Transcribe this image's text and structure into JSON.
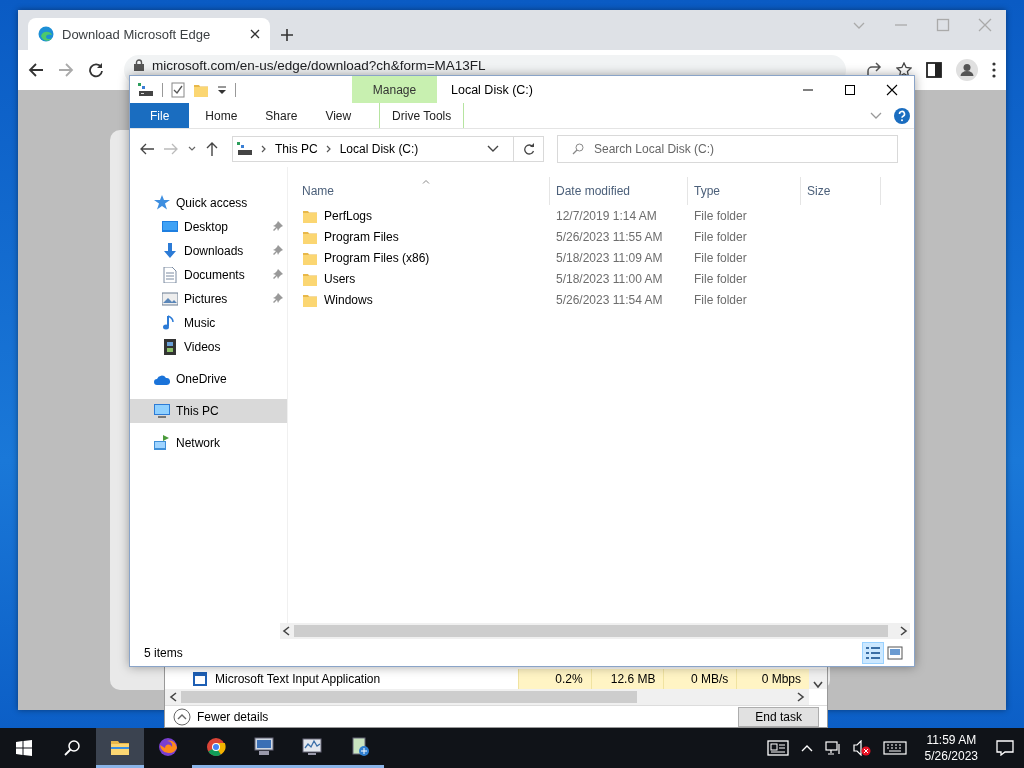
{
  "browser": {
    "tab_title": "Download Microsoft Edge",
    "address": "microsoft.com/en-us/edge/download?ch&form=MA13FL"
  },
  "explorer": {
    "title": "Local Disk (C:)",
    "context_group": "Manage",
    "ribbon_tabs": [
      {
        "label": "File",
        "kind": "file"
      },
      {
        "label": "Home",
        "kind": "plain"
      },
      {
        "label": "Share",
        "kind": "plain"
      },
      {
        "label": "View",
        "kind": "plain"
      },
      {
        "label": "Drive Tools",
        "kind": "context"
      }
    ],
    "breadcrumb": [
      "This PC",
      "Local Disk (C:)"
    ],
    "search": {
      "placeholder": "Search Local Disk (C:)"
    },
    "nav": [
      {
        "label": "Quick access",
        "selected": false,
        "children": [
          {
            "label": "Desktop",
            "pinned": true,
            "selected": false
          },
          {
            "label": "Downloads",
            "pinned": true,
            "selected": false
          },
          {
            "label": "Documents",
            "pinned": true,
            "selected": false
          },
          {
            "label": "Pictures",
            "pinned": true,
            "selected": false
          },
          {
            "label": "Music",
            "pinned": false,
            "selected": false
          },
          {
            "label": "Videos",
            "pinned": false,
            "selected": false
          }
        ]
      },
      {
        "label": "OneDrive",
        "selected": false
      },
      {
        "label": "This PC",
        "selected": true
      },
      {
        "label": "Network",
        "selected": false
      }
    ],
    "columns": [
      "Name",
      "Date modified",
      "Type",
      "Size"
    ],
    "rows": [
      {
        "name": "PerfLogs",
        "date": "12/7/2019 1:14 AM",
        "type": "File folder"
      },
      {
        "name": "Program Files",
        "date": "5/26/2023 11:55 AM",
        "type": "File folder"
      },
      {
        "name": "Program Files (x86)",
        "date": "5/18/2023 11:09 AM",
        "type": "File folder"
      },
      {
        "name": "Users",
        "date": "5/18/2023 11:00 AM",
        "type": "File folder"
      },
      {
        "name": "Windows",
        "date": "5/26/2023 11:54 AM",
        "type": "File folder"
      }
    ],
    "status": "5 items",
    "views": [
      {
        "selected": true
      },
      {
        "selected": false
      }
    ]
  },
  "task_manager": {
    "row": [
      "Microsoft Text Input Application",
      "0.2%",
      "12.6 MB",
      "0 MB/s",
      "0 Mbps"
    ],
    "fewer_details": "Fewer details",
    "end_task": "End task"
  },
  "taskbar": {
    "apps": [
      {
        "selected": true,
        "running": true
      },
      {
        "selected": false,
        "running": false
      },
      {
        "selected": false,
        "running": true
      },
      {
        "selected": false,
        "running": true
      },
      {
        "selected": false,
        "running": true
      },
      {
        "selected": false,
        "running": true
      }
    ],
    "time": "11:59 AM",
    "date": "5/26/2023"
  }
}
